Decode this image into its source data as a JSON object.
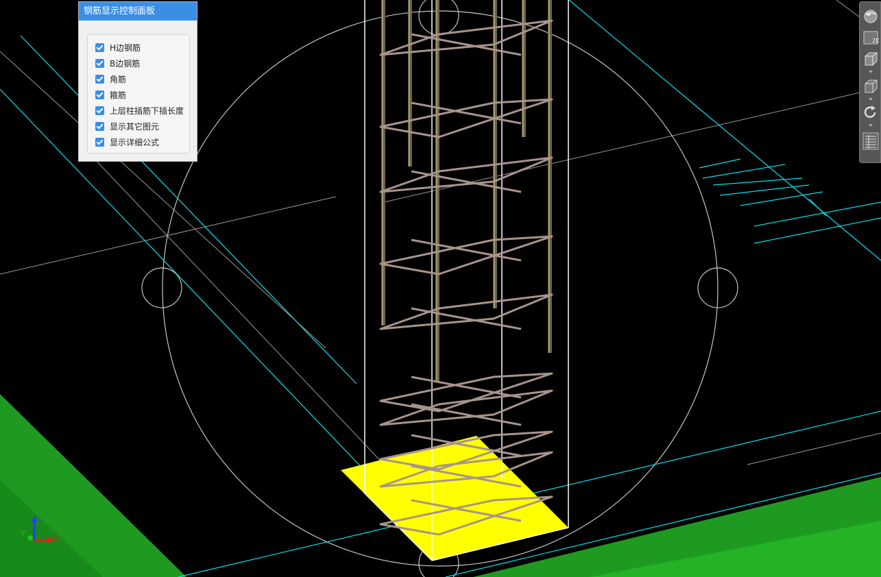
{
  "panel": {
    "title": "钢筋显示控制面板",
    "options": [
      {
        "label": "H边钢筋",
        "checked": true
      },
      {
        "label": "B边钢筋",
        "checked": true
      },
      {
        "label": "角筋",
        "checked": true
      },
      {
        "label": "箍筋",
        "checked": true
      },
      {
        "label": "上层柱插筋下插长度",
        "checked": true
      },
      {
        "label": "显示其它图元",
        "checked": true
      },
      {
        "label": "显示详细公式",
        "checked": true
      }
    ]
  },
  "toolbar": {
    "view_2d_label": "2D",
    "icons": [
      "render-sphere-icon",
      "view-2d-icon",
      "view-3d-box-icon",
      "cube-icon",
      "rotate-icon",
      "grid-list-icon"
    ]
  },
  "axis": {
    "x_label": "X",
    "y_label": "Y",
    "z_label": "Z",
    "x_color": "#e02020",
    "y_color": "#20c020",
    "z_color": "#2040ff"
  },
  "colors": {
    "background": "#000000",
    "ground_green": "#1f9a21",
    "pad_yellow": "#ffff00",
    "rebar": "#a8948c",
    "guide_cyan": "#00e5ee",
    "panel_accent": "#3a8ee6"
  }
}
